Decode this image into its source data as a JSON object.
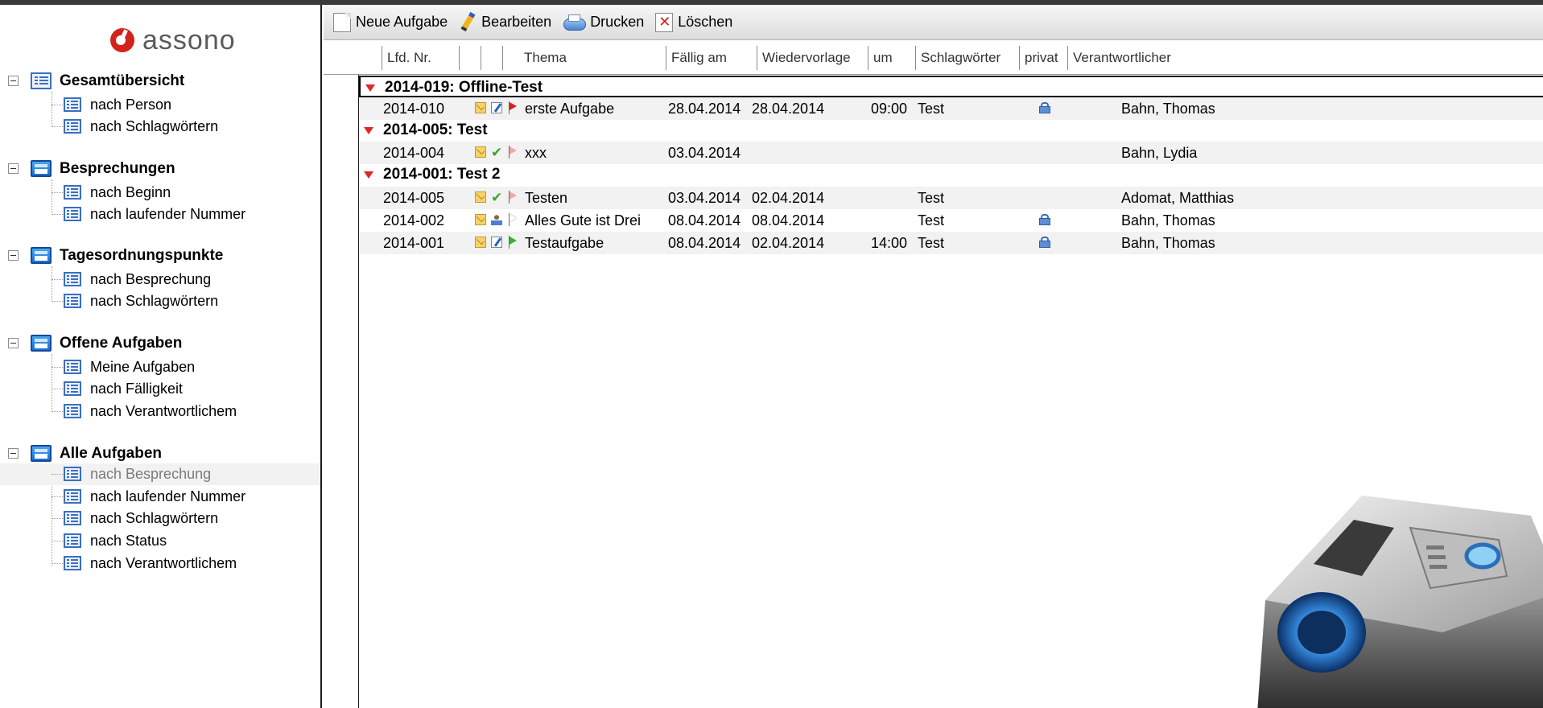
{
  "app": {
    "logo_text": "assono"
  },
  "sidebar": {
    "groups": [
      {
        "label": "Gesamtübersicht",
        "icon": "grid-view-icon",
        "items": [
          {
            "label": "nach Person"
          },
          {
            "label": "nach Schlagwörtern"
          }
        ]
      },
      {
        "label": "Besprechungen",
        "icon": "folder-icon",
        "items": [
          {
            "label": "nach Beginn"
          },
          {
            "label": "nach laufender Nummer"
          }
        ]
      },
      {
        "label": "Tagesordnungspunkte",
        "icon": "folder-icon",
        "items": [
          {
            "label": "nach Besprechung"
          },
          {
            "label": "nach Schlagwörtern"
          }
        ]
      },
      {
        "label": "Offene Aufgaben",
        "icon": "folder-icon",
        "items": [
          {
            "label": "Meine Aufgaben"
          },
          {
            "label": "nach Fälligkeit"
          },
          {
            "label": "nach Verantwortlichem"
          }
        ]
      },
      {
        "label": "Alle Aufgaben",
        "icon": "folder-icon",
        "items": [
          {
            "label": "nach Besprechung",
            "selected": true
          },
          {
            "label": "nach laufender Nummer"
          },
          {
            "label": "nach Schlagwörtern"
          },
          {
            "label": "nach Status"
          },
          {
            "label": "nach Verantwortlichem"
          }
        ]
      }
    ]
  },
  "toolbar": {
    "new_label": "Neue Aufgabe",
    "edit_label": "Bearbeiten",
    "print_label": "Drucken",
    "delete_label": "Löschen"
  },
  "table": {
    "columns": [
      "Lfd. Nr.",
      "",
      "",
      "Thema",
      "Fällig am",
      "Wiedervorlage",
      "um",
      "Schlagwörter",
      "privat",
      "Verantwortlicher"
    ],
    "groups": [
      {
        "title": "2014-019: Offline-Test",
        "rows": [
          {
            "nr": "2014-010",
            "status_icon": "edit-icon",
            "flag": "red",
            "thema": "erste Aufgabe",
            "faellig": "28.04.2014",
            "wiedervorlage": "28.04.2014",
            "um": "09:00",
            "schlagwoerter": "Test",
            "privat": true,
            "verantwortlicher": "Bahn, Thomas"
          }
        ]
      },
      {
        "title": "2014-005: Test",
        "rows": [
          {
            "nr": "2014-004",
            "status_icon": "check-icon",
            "flag": "pink",
            "thema": "xxx",
            "faellig": "03.04.2014",
            "wiedervorlage": "",
            "um": "",
            "schlagwoerter": "",
            "privat": false,
            "verantwortlicher": "Bahn, Lydia"
          }
        ]
      },
      {
        "title": "2014-001: Test 2",
        "rows": [
          {
            "nr": "2014-005",
            "status_icon": "check-icon",
            "flag": "pink",
            "thema": "Testen",
            "faellig": "03.04.2014",
            "wiedervorlage": "02.04.2014",
            "um": "",
            "schlagwoerter": "Test",
            "privat": false,
            "verantwortlicher": "Adomat, Matthias"
          },
          {
            "nr": "2014-002",
            "status_icon": "person-icon",
            "flag": "outline",
            "thema": "Alles Gute ist Drei",
            "faellig": "08.04.2014",
            "wiedervorlage": "08.04.2014",
            "um": "",
            "schlagwoerter": "Test",
            "privat": true,
            "verantwortlicher": "Bahn, Thomas"
          },
          {
            "nr": "2014-001",
            "status_icon": "edit-icon",
            "flag": "green",
            "thema": "Testaufgabe",
            "faellig": "08.04.2014",
            "wiedervorlage": "02.04.2014",
            "um": "14:00",
            "schlagwoerter": "Test",
            "privat": true,
            "verantwortlicher": "Bahn, Thomas"
          }
        ]
      }
    ]
  },
  "colors": {
    "accent_red": "#e0262a",
    "logo_red": "#d4231b",
    "link_blue": "#3a6fc0"
  }
}
